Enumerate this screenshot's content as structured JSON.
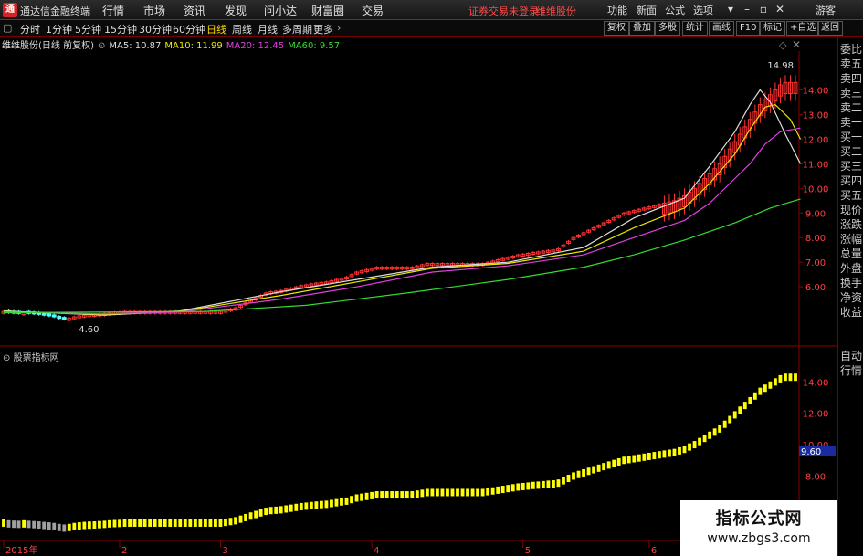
{
  "app": {
    "title": "通达信金融终端",
    "logo_glyph": "通"
  },
  "menu": [
    "行情",
    "市场",
    "资讯",
    "发现",
    "问小达",
    "财富圈",
    "交易"
  ],
  "warning": "证券交易未登录",
  "stock_short": "维维股份",
  "menu_right": [
    "功能",
    "新面",
    "公式",
    "选项",
    "游客"
  ],
  "window_buttons": [
    "▾",
    "–",
    "▫",
    "✕"
  ],
  "periods": [
    "分时",
    "1分钟",
    "5分钟",
    "15分钟",
    "30分钟",
    "60分钟",
    "日线",
    "周线",
    "月线",
    "多周期",
    "更多"
  ],
  "active_period": "日线",
  "toolbuttons": [
    "复权",
    "叠加",
    "多股",
    "统计",
    "画线",
    "F10",
    "标记",
    "+自选",
    "返回"
  ],
  "legend": {
    "name": "维维股份(日线 前复权)",
    "ma5": "MA5: 10.87",
    "ma10": "MA10: 11.99",
    "ma20": "MA20: 12.45",
    "ma60": "MA60: 9.57"
  },
  "right_panel": [
    "委比",
    "卖五",
    "卖四",
    "卖三",
    "卖二",
    "卖一",
    "买一",
    "买二",
    "买三",
    "买四",
    "买五",
    "现价",
    "涨跌",
    "涨幅",
    "总量",
    "外盘",
    "换手",
    "净资",
    "收益",
    "自动",
    "行情"
  ],
  "sub_label": "股票指标网",
  "watermark": {
    "line1": "指标公式网",
    "line2": "www.zbgs3.com"
  },
  "colors": {
    "up": "#ff3333",
    "down": "#54ffff",
    "ma5": "#dddddd",
    "ma10": "#e8e800",
    "ma20": "#e040e0",
    "ma60": "#33dd33",
    "bar_yellow": "#ffff00",
    "bar_gray": "#a0a0a0"
  },
  "chart_data": [
    {
      "type": "candlestick",
      "y_ticks": [
        14.0,
        13.0,
        12.0,
        11.0,
        10.0,
        9.0,
        8.0,
        7.0,
        6.0
      ],
      "ylim": [
        4.3,
        15.5
      ],
      "high_label": "14.98",
      "low_label": "4.60",
      "x_ticks": [
        {
          "label": "2015年",
          "i": 0
        },
        {
          "label": "2",
          "i": 23
        },
        {
          "label": "3",
          "i": 43
        },
        {
          "label": "4",
          "i": 73
        },
        {
          "label": "5",
          "i": 103
        },
        {
          "label": "6",
          "i": 128
        }
      ],
      "n": 158,
      "close": [
        5.0,
        4.95,
        4.93,
        4.92,
        4.95,
        4.92,
        4.9,
        4.88,
        4.85,
        4.82,
        4.78,
        4.72,
        4.68,
        4.72,
        4.78,
        4.82,
        4.85,
        4.87,
        4.88,
        4.9,
        4.92,
        4.95,
        4.97,
        4.98,
        5.0,
        5.0,
        5.0,
        5.0,
        5.0,
        5.0,
        5.0,
        5.0,
        5.0,
        5.0,
        5.0,
        5.0,
        5.0,
        5.0,
        5.0,
        5.0,
        5.0,
        5.0,
        5.0,
        5.0,
        5.05,
        5.1,
        5.15,
        5.25,
        5.35,
        5.45,
        5.55,
        5.65,
        5.75,
        5.8,
        5.82,
        5.85,
        5.9,
        5.95,
        6.0,
        6.05,
        6.08,
        6.12,
        6.15,
        6.18,
        6.2,
        6.25,
        6.3,
        6.35,
        6.4,
        6.5,
        6.6,
        6.65,
        6.7,
        6.75,
        6.8,
        6.8,
        6.8,
        6.8,
        6.8,
        6.8,
        6.8,
        6.8,
        6.85,
        6.9,
        6.95,
        6.95,
        6.95,
        6.95,
        6.95,
        6.95,
        6.95,
        6.95,
        6.95,
        6.95,
        6.95,
        6.95,
        7.0,
        7.05,
        7.1,
        7.15,
        7.2,
        7.25,
        7.3,
        7.33,
        7.36,
        7.4,
        7.42,
        7.45,
        7.48,
        7.5,
        7.55,
        7.7,
        7.85,
        8.0,
        8.1,
        8.2,
        8.3,
        8.4,
        8.5,
        8.6,
        8.7,
        8.8,
        8.9,
        9.0,
        9.05,
        9.1,
        9.15,
        9.2,
        9.25,
        9.3,
        9.35,
        9.4,
        9.45,
        9.5,
        9.6,
        9.7,
        9.85,
        10.0,
        10.2,
        10.4,
        10.6,
        10.8,
        11.0,
        11.3,
        11.6,
        11.9,
        12.2,
        12.5,
        12.8,
        13.1,
        13.4,
        13.6,
        13.8,
        14.0,
        14.2,
        14.3,
        14.3,
        14.3
      ],
      "series": [
        {
          "name": "MA5",
          "color": "#dddddd",
          "points": [
            [
              0,
              5.02
            ],
            [
              20,
              4.85
            ],
            [
              35,
              5.02
            ],
            [
              55,
              5.8
            ],
            [
              70,
              6.3
            ],
            [
              85,
              6.8
            ],
            [
              100,
              7.0
            ],
            [
              115,
              7.6
            ],
            [
              125,
              8.8
            ],
            [
              135,
              9.6
            ],
            [
              140,
              10.9
            ],
            [
              145,
              12.3
            ],
            [
              148,
              13.4
            ],
            [
              150,
              14.0
            ],
            [
              152,
              13.5
            ],
            [
              155,
              12.2
            ],
            [
              158,
              11.0
            ]
          ]
        },
        {
          "name": "MA10",
          "color": "#e8e800",
          "points": [
            [
              0,
              5.0
            ],
            [
              20,
              4.88
            ],
            [
              35,
              5.0
            ],
            [
              55,
              5.65
            ],
            [
              70,
              6.2
            ],
            [
              85,
              6.75
            ],
            [
              100,
              6.95
            ],
            [
              115,
              7.45
            ],
            [
              125,
              8.4
            ],
            [
              135,
              9.2
            ],
            [
              140,
              10.2
            ],
            [
              145,
              11.4
            ],
            [
              148,
              12.4
            ],
            [
              151,
              13.3
            ],
            [
              153,
              13.4
            ],
            [
              156,
              12.8
            ],
            [
              158,
              12.0
            ]
          ]
        },
        {
          "name": "MA20",
          "color": "#e040e0",
          "points": [
            [
              0,
              4.98
            ],
            [
              20,
              4.9
            ],
            [
              35,
              4.98
            ],
            [
              55,
              5.5
            ],
            [
              70,
              6.0
            ],
            [
              85,
              6.6
            ],
            [
              100,
              6.85
            ],
            [
              115,
              7.3
            ],
            [
              125,
              8.0
            ],
            [
              135,
              8.7
            ],
            [
              140,
              9.4
            ],
            [
              145,
              10.4
            ],
            [
              148,
              11.0
            ],
            [
              151,
              11.8
            ],
            [
              154,
              12.3
            ],
            [
              158,
              12.45
            ]
          ]
        },
        {
          "name": "MA60",
          "color": "#33dd33",
          "points": [
            [
              0,
              4.95
            ],
            [
              40,
              5.0
            ],
            [
              60,
              5.25
            ],
            [
              80,
              5.75
            ],
            [
              100,
              6.3
            ],
            [
              115,
              6.8
            ],
            [
              125,
              7.3
            ],
            [
              135,
              7.9
            ],
            [
              145,
              8.6
            ],
            [
              152,
              9.2
            ],
            [
              158,
              9.57
            ]
          ]
        }
      ]
    },
    {
      "type": "bar",
      "y_ticks": [
        14.0,
        12.0,
        10.0,
        8.0
      ],
      "current_label": "9.60",
      "values": [
        5.0,
        4.95,
        4.93,
        4.92,
        4.95,
        4.92,
        4.9,
        4.88,
        4.85,
        4.82,
        4.78,
        4.72,
        4.68,
        4.72,
        4.78,
        4.82,
        4.85,
        4.87,
        4.88,
        4.9,
        4.92,
        4.95,
        4.97,
        4.98,
        5.0,
        5.0,
        5.0,
        5.0,
        5.0,
        5.0,
        5.0,
        5.0,
        5.0,
        5.0,
        5.0,
        5.0,
        5.0,
        5.0,
        5.0,
        5.0,
        5.0,
        5.0,
        5.0,
        5.0,
        5.05,
        5.1,
        5.15,
        5.25,
        5.35,
        5.45,
        5.55,
        5.65,
        5.75,
        5.8,
        5.82,
        5.85,
        5.9,
        5.95,
        6.0,
        6.05,
        6.08,
        6.12,
        6.15,
        6.18,
        6.2,
        6.25,
        6.3,
        6.35,
        6.4,
        6.5,
        6.6,
        6.65,
        6.7,
        6.75,
        6.8,
        6.8,
        6.8,
        6.8,
        6.8,
        6.8,
        6.8,
        6.8,
        6.85,
        6.9,
        6.95,
        6.95,
        6.95,
        6.95,
        6.95,
        6.95,
        6.95,
        6.95,
        6.95,
        6.95,
        6.95,
        6.95,
        7.0,
        7.05,
        7.1,
        7.15,
        7.2,
        7.25,
        7.3,
        7.33,
        7.36,
        7.4,
        7.42,
        7.45,
        7.48,
        7.5,
        7.55,
        7.7,
        7.85,
        8.0,
        8.1,
        8.2,
        8.3,
        8.4,
        8.5,
        8.6,
        8.7,
        8.8,
        8.9,
        9.0,
        9.05,
        9.1,
        9.15,
        9.2,
        9.25,
        9.3,
        9.35,
        9.4,
        9.45,
        9.5,
        9.6,
        9.7,
        9.85,
        10.0,
        10.2,
        10.4,
        10.6,
        10.8,
        11.0,
        11.3,
        11.6,
        11.9,
        12.2,
        12.5,
        12.8,
        13.1,
        13.4,
        13.6,
        13.8,
        14.0,
        14.2,
        14.3,
        14.3,
        14.3
      ]
    }
  ]
}
